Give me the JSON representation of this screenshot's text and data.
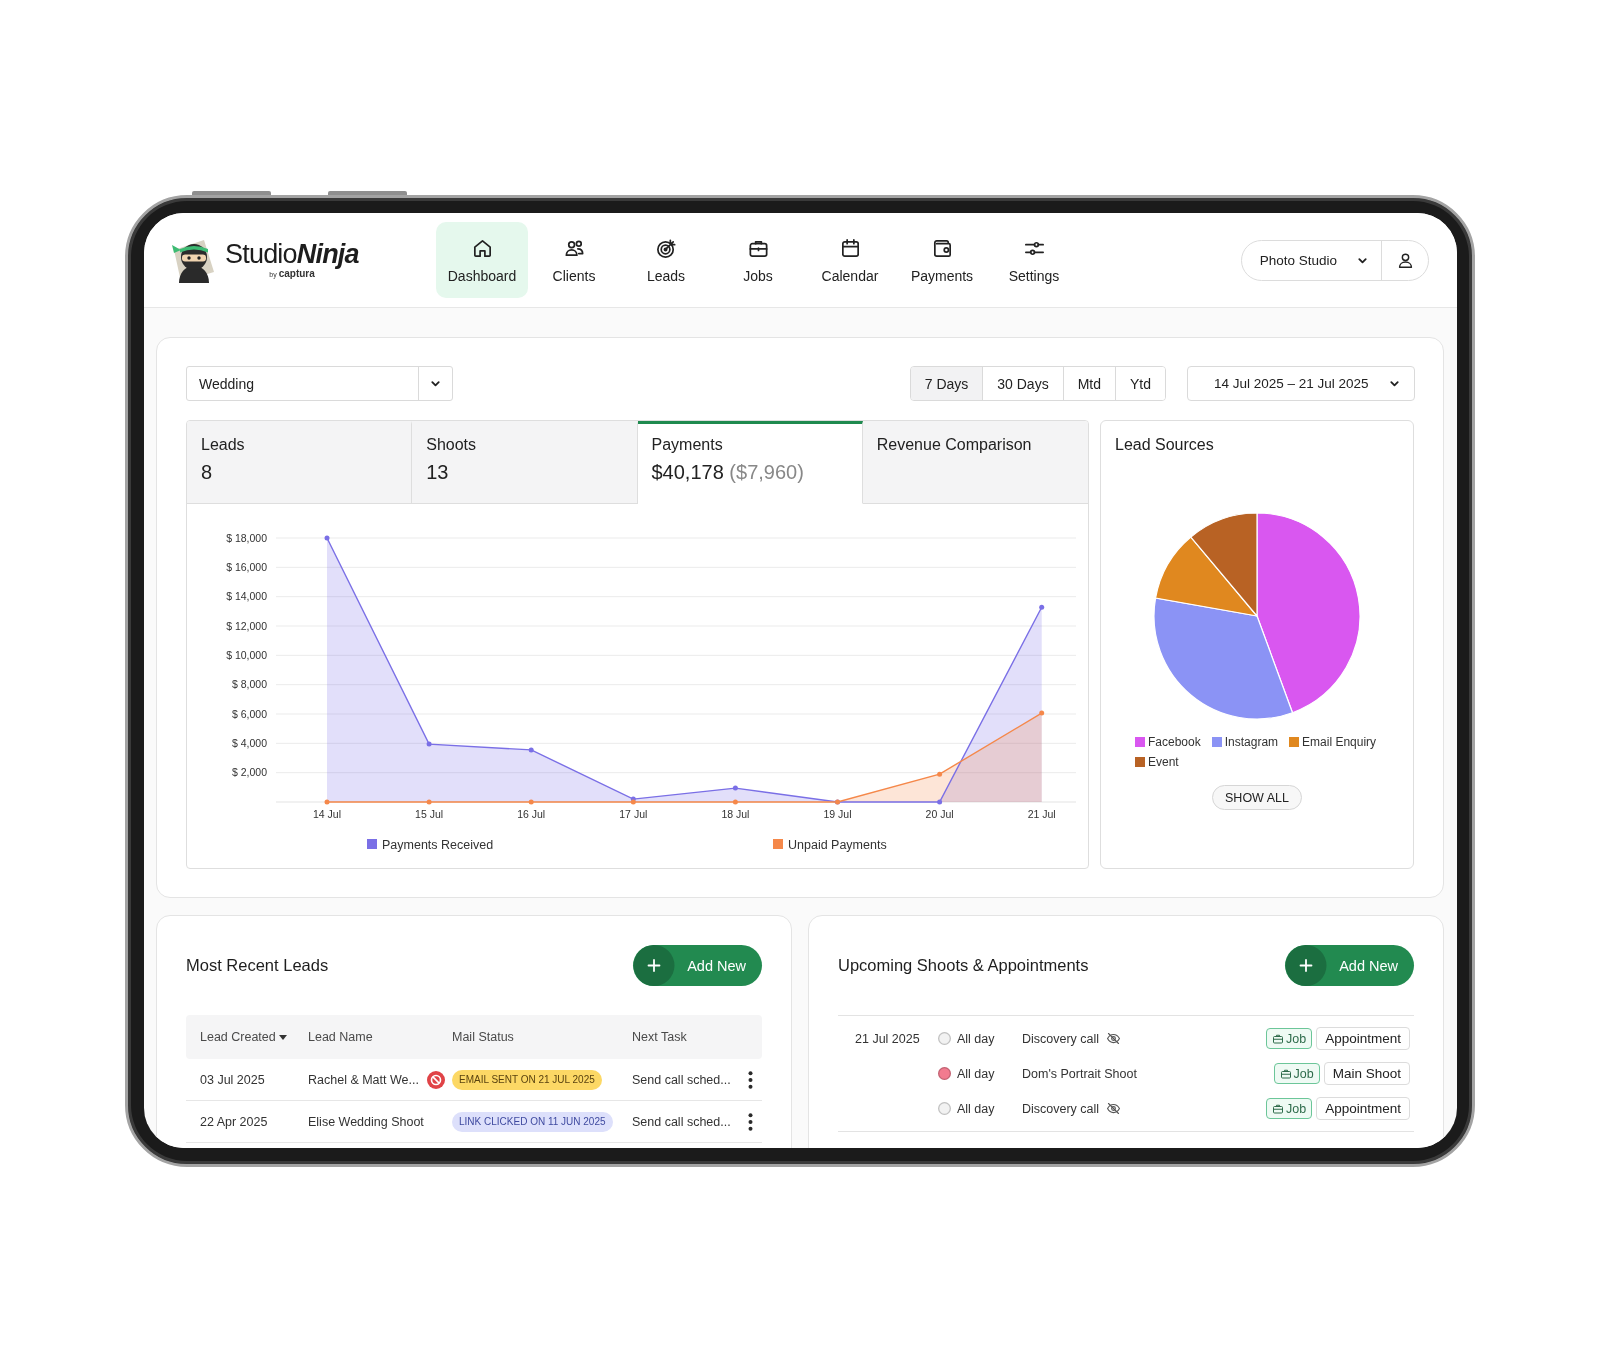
{
  "header": {
    "logo": {
      "wordmark": "Studio**Ninja**",
      "tagline": "by **captura**"
    },
    "nav": [
      {
        "label": "Dashboard",
        "selected": true
      },
      {
        "label": "Clients",
        "selected": false
      },
      {
        "label": "Leads",
        "selected": false
      },
      {
        "label": "Jobs",
        "selected": false
      },
      {
        "label": "Calendar",
        "selected": false
      },
      {
        "label": "Payments",
        "selected": false
      },
      {
        "label": "Settings",
        "selected": false
      }
    ],
    "account": {
      "studio": "Photo Studio"
    }
  },
  "overview": {
    "category_select": {
      "value": "Wedding"
    },
    "ranges": [
      {
        "label": "7 Days",
        "selected": true
      },
      {
        "label": "30 Days",
        "selected": false
      },
      {
        "label": "Mtd",
        "selected": false
      },
      {
        "label": "Ytd",
        "selected": false
      }
    ],
    "date_range": {
      "value": "14 Jul 2025 – 21 Jul 2025"
    },
    "stats": [
      {
        "label": "Leads",
        "value": "8",
        "selected": false
      },
      {
        "label": "Shoots",
        "value": "13",
        "selected": false
      },
      {
        "label": "Payments",
        "value": "$40,178",
        "secondary": "($7,960)",
        "selected": true
      },
      {
        "label": "Revenue Comparison",
        "selected": false
      }
    ],
    "payments_chart": {
      "chart_data": {
        "type": "area",
        "categories": [
          "14 Jul",
          "15 Jul",
          "16 Jul",
          "17 Jul",
          "18 Jul",
          "19 Jul",
          "20 Jul",
          "21 Jul"
        ],
        "series": [
          {
            "name": "Payments Received",
            "type": "area",
            "color": "#7a6fe6",
            "values": [
              18000,
              3950,
              3550,
              200,
              950,
              0,
              0,
              13280
            ]
          },
          {
            "name": "Unpaid Payments",
            "type": "area",
            "color": "#f5884a",
            "values": [
              0,
              0,
              0,
              0,
              0,
              0,
              1900,
              6060
            ]
          }
        ],
        "ylim": [
          0,
          18000
        ],
        "yticks": [
          {
            "value": 2000,
            "label": "$ 2,000"
          },
          {
            "value": 4000,
            "label": "$ 4,000"
          },
          {
            "value": 6000,
            "label": "$ 6,000"
          },
          {
            "value": 8000,
            "label": "$ 8,000"
          },
          {
            "value": 10000,
            "label": "$ 10,000"
          },
          {
            "value": 12000,
            "label": "$ 12,000"
          },
          {
            "value": 14000,
            "label": "$ 14,000"
          },
          {
            "value": 16000,
            "label": "$ 16,000"
          },
          {
            "value": 18000,
            "label": "$ 18,000"
          }
        ],
        "grid": true,
        "legend": "bottom"
      }
    },
    "lead_sources": {
      "title": "Lead Sources",
      "chart_data": {
        "type": "pie",
        "categories": [
          "Facebook",
          "Instagram",
          "Email Enquiry",
          "Event"
        ],
        "values": [
          44.4,
          33.4,
          11.1,
          11.1
        ],
        "colors": [
          "#d957f0",
          "#8b93f5",
          "#e0881f",
          "#b86224"
        ]
      },
      "button": "SHOW ALL"
    }
  },
  "recent_leads": {
    "title": "Most Recent Leads",
    "add_button": "Add New",
    "columns": [
      {
        "label": "Lead Created",
        "sorted": true
      },
      {
        "label": "Lead Name",
        "sorted": false
      },
      {
        "label": "Mail Status",
        "sorted": false
      },
      {
        "label": "Next Task",
        "sorted": false
      }
    ],
    "rows": [
      {
        "created": "03 Jul 2025",
        "name": "Rachel & Matt We...",
        "blocked": true,
        "mail_status": {
          "text": "EMAIL SENT ON 21 JUL 2025",
          "kind": "sent"
        },
        "next_task": "Send call sched..."
      },
      {
        "created": "22 Apr 2025",
        "name": "Elise Wedding Shoot",
        "blocked": false,
        "mail_status": {
          "text": "LINK CLICKED ON 11 JUN 2025",
          "kind": "clicked"
        },
        "next_task": "Send call sched..."
      }
    ]
  },
  "upcoming": {
    "title": "Upcoming Shoots & Appointments",
    "add_button": "Add New",
    "groups": [
      {
        "date": "21 Jul 2025",
        "events": [
          {
            "color": "#f2f2f2",
            "time": "All day",
            "title": "Discovery call",
            "hidden": true,
            "tag": "Job",
            "type": "Appointment"
          },
          {
            "color": "#f27b8f",
            "time": "All day",
            "title": "Dom's Portrait Shoot",
            "hidden": false,
            "tag": "Job",
            "type": "Main Shoot"
          },
          {
            "color": "#f2f2f2",
            "time": "All day",
            "title": "Discovery call",
            "hidden": true,
            "tag": "Job",
            "type": "Appointment"
          }
        ]
      }
    ]
  }
}
